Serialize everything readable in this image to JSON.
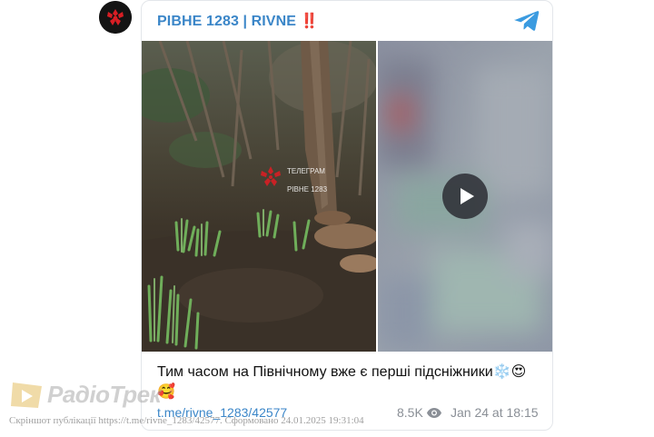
{
  "channel": {
    "name": "РІВНЕ 1283 | RIVNE ‼️",
    "avatar_icon": "flower-emblem-icon",
    "platform_icon": "telegram-icon",
    "accent_color": "#3b86c8"
  },
  "media": {
    "photo_overlay": {
      "line1": "ТЕЛЕГРАМ",
      "line2": "РІВНЕ 1283"
    },
    "video_icon": "play-icon"
  },
  "post": {
    "text": "Тим часом на Північному вже є перші підсніжники❄️😍🥰",
    "link": "t.me/rivne_1283/42577",
    "views": "8.5K",
    "date": "Jan 24 at 18:15"
  },
  "watermark": {
    "logo_text": "РадіоТрек",
    "caption": "Скріншот публікації https://t.me/rivne_1283/42577. Сформовано 24.01.2025 19:31:04"
  }
}
